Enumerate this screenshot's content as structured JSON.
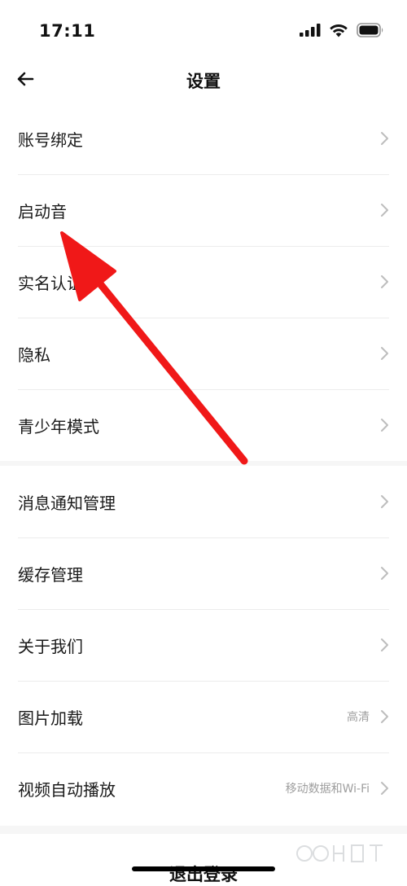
{
  "status_bar": {
    "time": "17:11",
    "icons": [
      "cellular-signal-icon",
      "wifi-icon",
      "battery-icon"
    ]
  },
  "nav": {
    "back_icon": "arrow-left-icon",
    "title": "设置"
  },
  "group1": {
    "items": [
      {
        "label": "账号绑定"
      },
      {
        "label": "启动音"
      },
      {
        "label": "实名认证"
      },
      {
        "label": "隐私"
      },
      {
        "label": "青少年模式"
      }
    ]
  },
  "group2": {
    "items": [
      {
        "label": "消息通知管理",
        "value": ""
      },
      {
        "label": "缓存管理",
        "value": ""
      },
      {
        "label": "关于我们",
        "value": ""
      },
      {
        "label": "图片加载",
        "value": "高清"
      },
      {
        "label": "视频自动播放",
        "value": "移动数据和Wi-Fi"
      }
    ]
  },
  "logout": {
    "label": "退出登录"
  },
  "colors": {
    "annotation_arrow": "#f01818",
    "chevron": "#bdbdbd",
    "value_text": "#9e9e9e",
    "divider": "#ececec"
  }
}
